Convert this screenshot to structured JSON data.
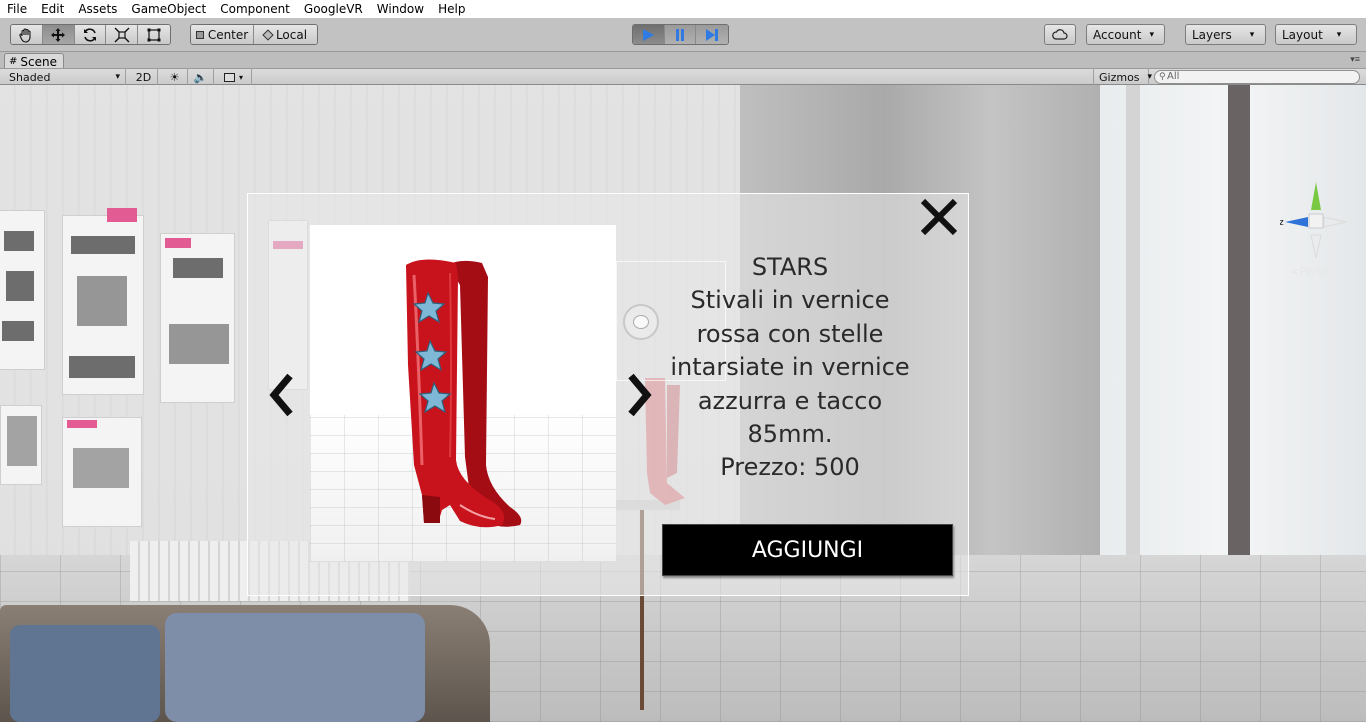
{
  "menu": [
    "File",
    "Edit",
    "Assets",
    "GameObject",
    "Component",
    "GoogleVR",
    "Window",
    "Help"
  ],
  "toolbar": {
    "tools": [
      "hand-tool",
      "move-tool",
      "rotate-tool",
      "scale-tool",
      "rect-tool"
    ],
    "pivot_center": "Center",
    "pivot_local": "Local",
    "account": "Account",
    "layers": "Layers",
    "layout": "Layout"
  },
  "scene": {
    "tab": "Scene",
    "shading": "Shaded",
    "mode_2d": "2D",
    "gizmos": "Gizmos",
    "search_placeholder": "All",
    "persp": "Persp",
    "axis_z": "z"
  },
  "product": {
    "title": "STARS",
    "description_lines": [
      "Stivali in vernice",
      "rossa con stelle",
      "intarsiate in vernice",
      "azzurra e tacco",
      "85mm."
    ],
    "price": "Prezzo: 500",
    "add_button": "AGGIUNGI"
  },
  "colors": {
    "boot": "#c8121c",
    "star": "#6fa9c9",
    "gizmo_y": "#7ac943",
    "gizmo_x": "#2f73d9"
  }
}
